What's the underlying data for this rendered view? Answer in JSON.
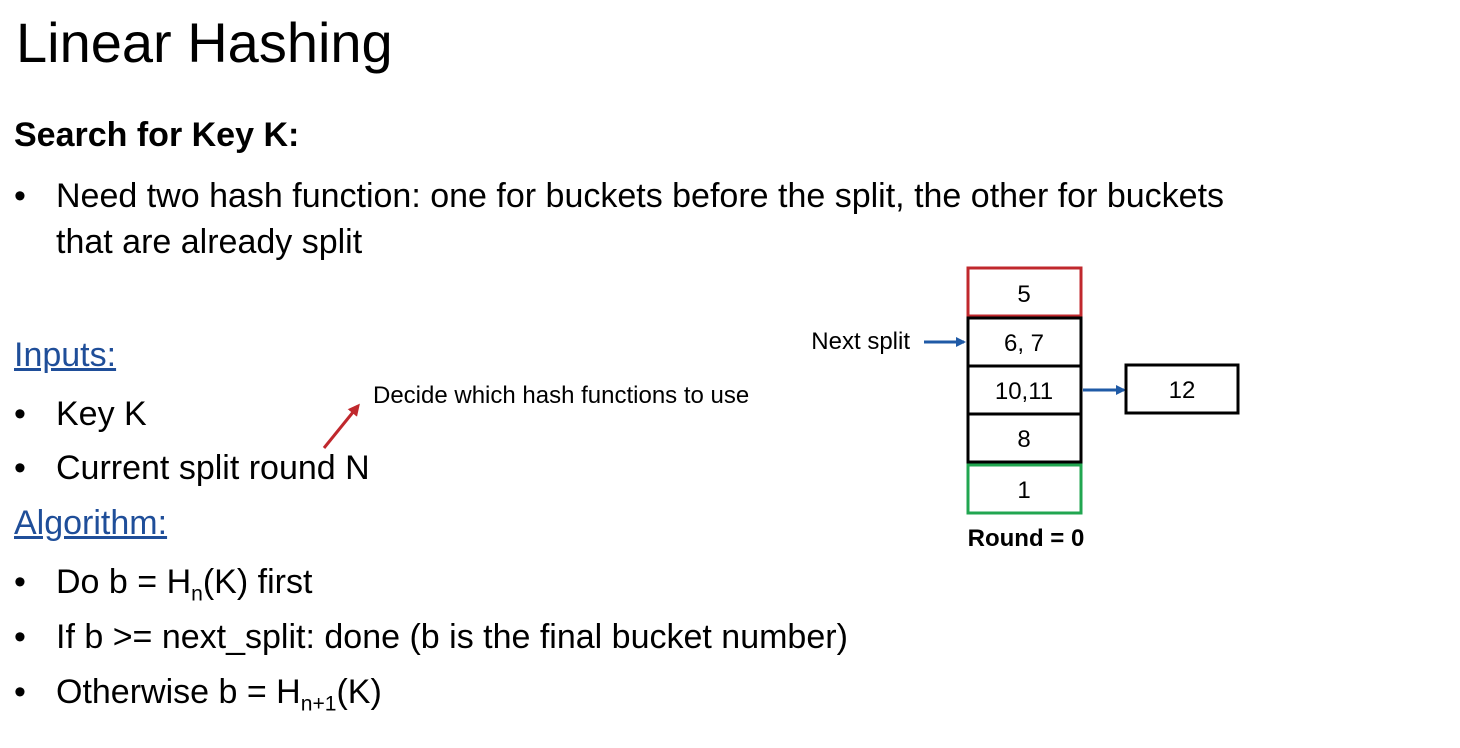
{
  "title": "Linear Hashing",
  "subheading": "Search for Key K:",
  "intro_bullet": {
    "line1": "Need two hash function: one for buckets before the split, the other for buckets",
    "line2": "that are already split"
  },
  "inputs": {
    "heading": "Inputs:",
    "items": [
      "Key K",
      "Current split round N"
    ]
  },
  "annotation": "Decide which hash functions to use",
  "algorithm": {
    "heading": "Algorithm:",
    "step1": {
      "pre": "Do b = H",
      "sub": "n",
      "post": "(K) first"
    },
    "step2": "If b >= next_split: done (b is the final bucket number)",
    "step3": {
      "pre": "Otherwise b = H",
      "sub": "n+1",
      "post": "(K)"
    }
  },
  "diagram": {
    "buckets": [
      "5",
      "6, 7",
      "10,11",
      "8",
      "1"
    ],
    "overflow": "12",
    "next_split_label": "Next split",
    "round_label": "Round = 0",
    "colors": {
      "first_bucket_border": "#c0282d",
      "last_bucket_border": "#21a650",
      "arrow_blue": "#1f5aa6",
      "arrow_red": "#c0282d",
      "heading_blue": "#1f4e99"
    }
  }
}
